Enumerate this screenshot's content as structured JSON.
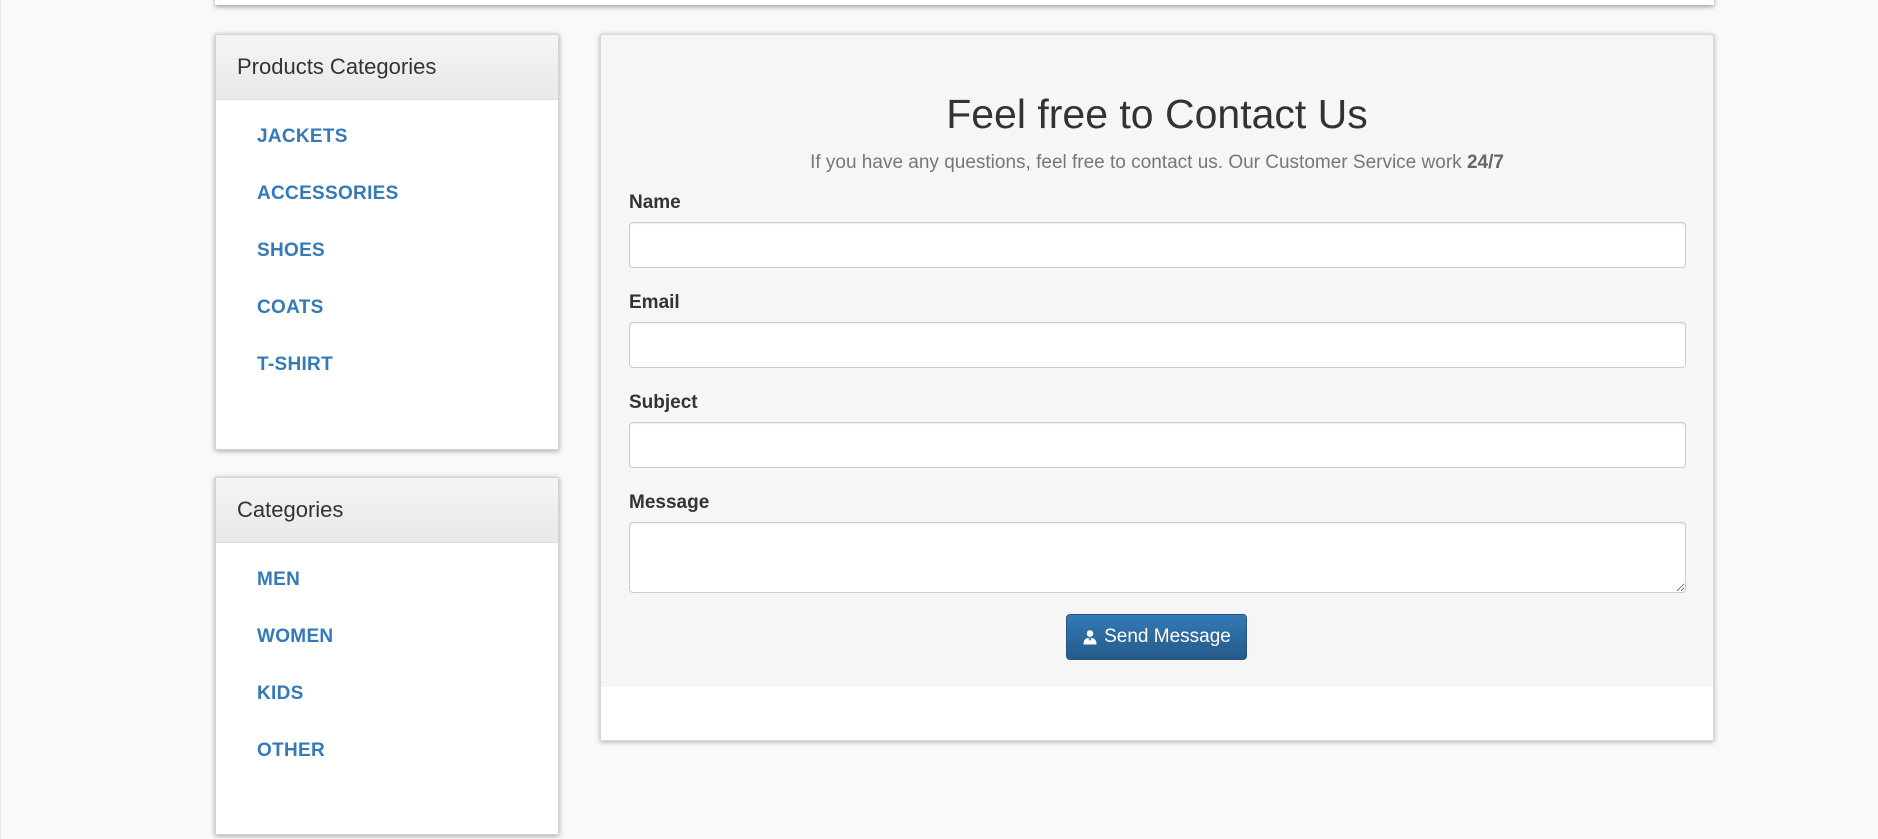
{
  "sidebar": {
    "product_categories": {
      "title": "Products Categories",
      "items": [
        "JACKETS",
        "ACCESSORIES",
        "SHOES",
        "COATS",
        "T-SHIRT"
      ]
    },
    "categories": {
      "title": "Categories",
      "items": [
        "MEN",
        "WOMEN",
        "KIDS",
        "OTHER"
      ]
    }
  },
  "contact": {
    "title": "Feel free to Contact Us",
    "subtitle": "If you have any questions, feel free to contact us. Our Customer Service work",
    "subtitle_emphasis": "24/7",
    "fields": {
      "name_label": "Name",
      "name_value": "",
      "email_label": "Email",
      "email_value": "",
      "subject_label": "Subject",
      "subject_value": "",
      "message_label": "Message",
      "message_value": ""
    },
    "send_button": {
      "label": "Send Message",
      "icon": "user-icon"
    }
  },
  "colors": {
    "link": "#337ab7",
    "button": "#2e6da4",
    "background": "#f9f9f9"
  }
}
